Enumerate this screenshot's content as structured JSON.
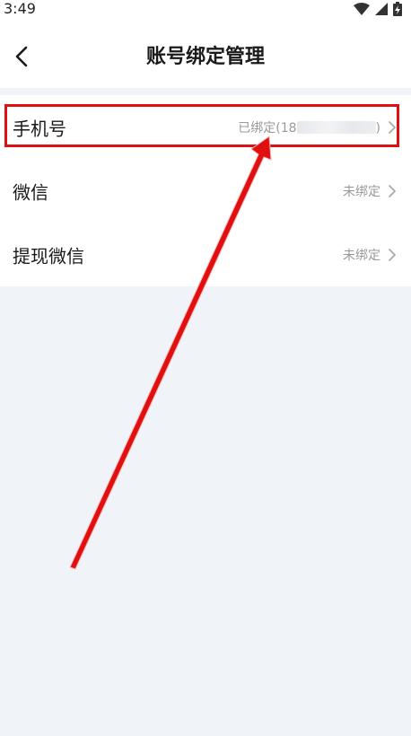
{
  "status_bar": {
    "time": "3:49",
    "icons": [
      "wifi-icon",
      "signal-icon",
      "battery-charging-icon"
    ]
  },
  "header": {
    "title": "账号绑定管理",
    "back_icon": "chevron-left-icon"
  },
  "bindings": [
    {
      "label": "手机号",
      "status_prefix": "已绑定(18",
      "status_masked": true,
      "status_suffix": ")"
    },
    {
      "label": "微信",
      "status": "未绑定"
    },
    {
      "label": "提现微信",
      "status": "未绑定"
    }
  ],
  "annotation": {
    "highlight_color": "#e11010",
    "arrow_color": "#e11010"
  },
  "colors": {
    "background": "#f0f3f7",
    "surface": "#ffffff",
    "text_primary": "#1a1a1a",
    "text_secondary": "#999999"
  }
}
